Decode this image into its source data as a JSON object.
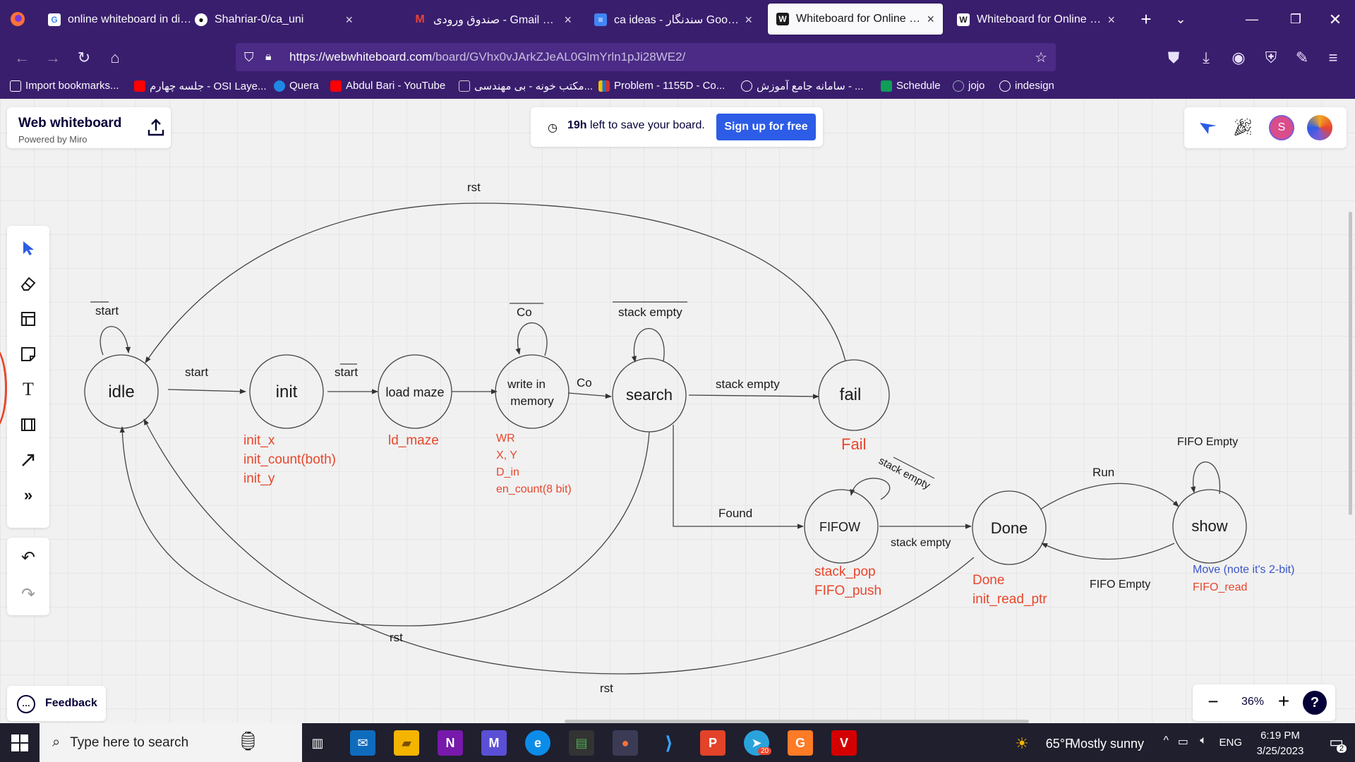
{
  "browser": {
    "tabs": [
      {
        "title": "online whiteboard in discord",
        "favicon": "google-icon"
      },
      {
        "title": "Shahriar-0/ca_uni",
        "favicon": "github-icon"
      },
      {
        "title": "صندوق ورودی - Gmail com",
        "favicon": "gmail-icon"
      },
      {
        "title": "ca ideas - سندنگار Google",
        "favicon": "docs-icon"
      },
      {
        "title": "Whiteboard for Online Colla",
        "favicon": "w-icon",
        "active": true
      },
      {
        "title": "Whiteboard for Online Colla",
        "favicon": "w-icon"
      }
    ],
    "url_host": "https://webwhiteboard.com",
    "url_path": "/board/GVhx0vJArkZJeAL0GlmYrln1pJi28WE2/",
    "bookmarks": [
      "Import bookmarks...",
      "جلسه چهارم - OSI Laye...",
      "Quera",
      "Abdul Bari - YouTube",
      "مکتب خونه - بی مهندسی...",
      "Problem - 1155D - Co...",
      "سامانه جامع آموزش - ...",
      "Schedule",
      "jojo",
      "indesign"
    ]
  },
  "app": {
    "brand_title": "Web whiteboard",
    "brand_sub": "Powered by Miro",
    "save_hours": "19h",
    "save_rest": "left to save your board.",
    "signup_label": "Sign up for free",
    "avatar_letter": "S",
    "feedback_label": "Feedback",
    "zoom_level": "36%",
    "help_label": "?"
  },
  "diagram": {
    "states": {
      "idle": "idle",
      "init": "init",
      "load": "load maze",
      "write1": "write in",
      "write2": "memory",
      "search": "search",
      "fail": "fail",
      "fifow": "FIFOW",
      "done": "Done",
      "show": "show"
    },
    "edge_labels": {
      "rst_top": "rst",
      "start_self": "start",
      "start": "start",
      "start_bar": "start",
      "co_self": "Co",
      "co": "Co",
      "stack_empty_self": "stack empty",
      "stack_empty_fail": "stack empty",
      "found": "Found",
      "stack_empty_fifow_self": "stack empty",
      "stack_empty_done": "stack empty",
      "run": "Run",
      "fifo_empty_self": "FIFO Empty",
      "fifo_empty_back": "FIFO Empty",
      "rst_mid": "rst",
      "rst_bottom": "rst"
    },
    "outputs": {
      "init": [
        "init_x",
        "init_count(both)",
        "init_y"
      ],
      "load": [
        "ld_maze"
      ],
      "write": [
        "WR",
        "X, Y",
        "D_in",
        "en_count(8 bit)"
      ],
      "fail": [
        "Fail"
      ],
      "fifow": [
        "stack_pop",
        "FIFO_push"
      ],
      "done": [
        "Done",
        "init_read_ptr"
      ],
      "show_blue": "Move (note it's 2-bit)",
      "show_red": "FIFO_read"
    }
  },
  "taskbar": {
    "search_placeholder": "Type here to search",
    "weather_temp": "65°F",
    "weather_text": "Mostly sunny",
    "lang": "ENG",
    "time": "6:19 PM",
    "date": "3/25/2023",
    "notif_count": "2",
    "telegram_badge": "20"
  },
  "colors": {
    "chrome_purple": "#3a1e6e",
    "output_red": "#e8462c",
    "output_blue": "#3a55c8",
    "miro_blue": "#2d5ce6"
  }
}
